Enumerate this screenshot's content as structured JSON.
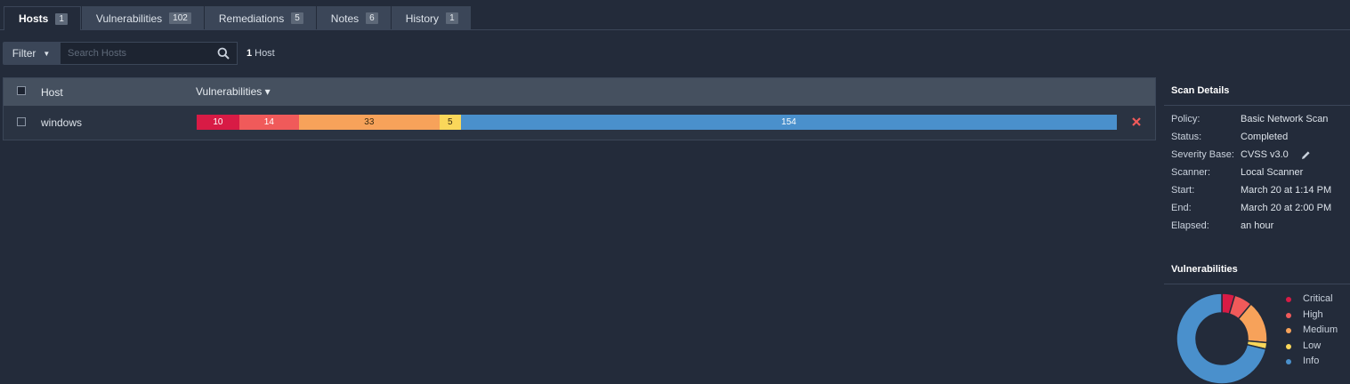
{
  "tabs": [
    {
      "label": "Hosts",
      "count": "1",
      "active": true
    },
    {
      "label": "Vulnerabilities",
      "count": "102"
    },
    {
      "label": "Remediations",
      "count": "5"
    },
    {
      "label": "Notes",
      "count": "6"
    },
    {
      "label": "History",
      "count": "1"
    }
  ],
  "filter": {
    "label": "Filter"
  },
  "search": {
    "placeholder": "Search Hosts"
  },
  "host_count": {
    "number": "1",
    "label": "Host"
  },
  "table": {
    "headers": {
      "host": "Host",
      "vulnerabilities": "Vulnerabilities ▾"
    },
    "rows": [
      {
        "host": "windows",
        "critical": "10",
        "high": "14",
        "medium": "33",
        "low": "5",
        "info": "154"
      }
    ]
  },
  "colors": {
    "critical": "#d81b45",
    "high": "#f05a5a",
    "medium": "#f7a25a",
    "low": "#fad75a",
    "info": "#4a90cc"
  },
  "scan_details": {
    "title": "Scan Details",
    "rows": [
      {
        "key": "Policy:",
        "value": "Basic Network Scan"
      },
      {
        "key": "Status:",
        "value": "Completed"
      },
      {
        "key": "Severity Base:",
        "value": "CVSS v3.0"
      },
      {
        "key": "Scanner:",
        "value": "Local Scanner"
      },
      {
        "key": "Start:",
        "value": "March 20 at 1:14 PM"
      },
      {
        "key": "End:",
        "value": "March 20 at 2:00 PM"
      },
      {
        "key": "Elapsed:",
        "value": "an hour"
      }
    ]
  },
  "vulnerabilities_panel": {
    "title": "Vulnerabilities",
    "legend": [
      "Critical",
      "High",
      "Medium",
      "Low",
      "Info"
    ]
  },
  "chart_data": {
    "type": "pie",
    "categories": [
      "Critical",
      "High",
      "Medium",
      "Low",
      "Info"
    ],
    "values": [
      10,
      14,
      33,
      5,
      154
    ],
    "colors": [
      "#d81b45",
      "#f05a5a",
      "#f7a25a",
      "#fad75a",
      "#4a90cc"
    ]
  },
  "icons": {
    "filter_caret": "caret-down-icon",
    "search": "search-icon",
    "remove": "close-icon",
    "edit": "pencil-icon"
  }
}
